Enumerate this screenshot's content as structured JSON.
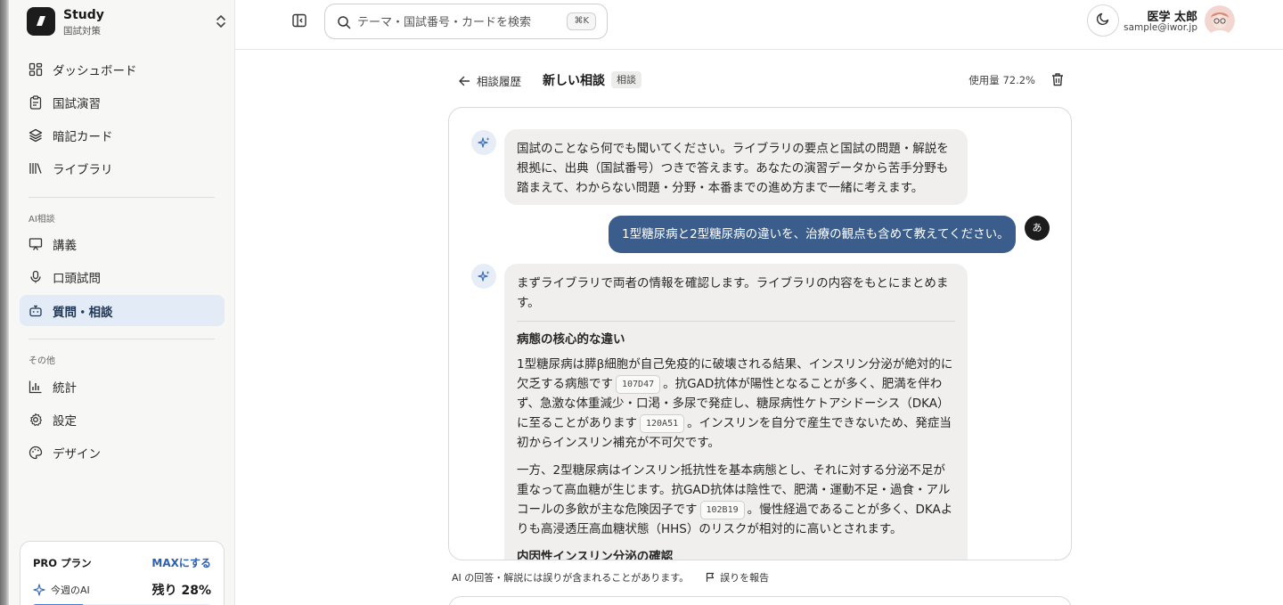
{
  "app": {
    "title": "Study",
    "subtitle": "国試対策"
  },
  "sidebar": {
    "main_items": [
      {
        "label": "ダッシュボード",
        "icon": "dashboard-icon"
      },
      {
        "label": "国試演習",
        "icon": "clipboard-icon"
      },
      {
        "label": "暗記カード",
        "icon": "layers-icon"
      },
      {
        "label": "ライブラリ",
        "icon": "library-icon"
      }
    ],
    "ai_section_label": "AI相談",
    "ai_items": [
      {
        "label": "講義",
        "icon": "presentation-icon"
      },
      {
        "label": "口頭試問",
        "icon": "microphone-icon"
      },
      {
        "label": "質問・相談",
        "icon": "bot-icon",
        "active": true
      }
    ],
    "other_section_label": "その他",
    "other_items": [
      {
        "label": "統計",
        "icon": "bar-chart-icon"
      },
      {
        "label": "設定",
        "icon": "gear-icon"
      },
      {
        "label": "デザイン",
        "icon": "palette-icon"
      }
    ],
    "plan": {
      "name": "PRO プラン",
      "upgrade_label": "MAXにする",
      "weekly_ai_label": "今週のAI",
      "remaining_label": "残り 28%",
      "remaining_fraction": 0.28
    }
  },
  "header": {
    "search_placeholder": "テーマ・国試番号・カードを検索",
    "search_shortcut": "⌘K",
    "user_name": "医学 太郎",
    "user_email": "sample@iwor.jp"
  },
  "chat": {
    "back_label": "相談履歴",
    "title": "新しい相談",
    "tag": "相談",
    "usage_label": "使用量 72.2%",
    "user_initial": "あ",
    "intro_message": "国試のことなら何でも聞いてください。ライブラリの要点と国試の問題・解説を根拠に、出典（国試番号）つきで答えます。あなたの演習データから苦手分野も踏まえて、わからない問題・分野・本番までの進め方まで一緒に考えます。",
    "user_message": "1型糖尿病と2型糖尿病の違いを、治療の観点も含めて教えてください。",
    "answer": {
      "lead": "まずライブラリで両者の情報を確認します。ライブラリの内容をもとにまとめます。",
      "heading1": "病態の核心的な違い",
      "p1_a": "1型糖尿病は膵β細胞が自己免疫的に破壊される結果、インスリン分泌が絶対的に欠乏する病態です",
      "p1_ref1": "107D47",
      "p1_b": "。抗GAD抗体が陽性となることが多く、肥満を伴わず、急激な体重減少・口渇・多尿で発症し、糖尿病性ケトアシドーシス（DKA）に至ることがあります",
      "p1_ref2": "120A51",
      "p1_c": "。インスリンを自分で産生できないため、発症当初からインスリン補充が不可欠です。",
      "p2_a": "一方、2型糖尿病はインスリン抵抗性を基本病態とし、それに対する分泌不足が重なって高血糖が生じます。抗GAD抗体は陰性で、肥満・運動不足・過食・アルコールの多飲が主な危険因子です",
      "p2_ref": "102B19",
      "p2_b": "。慢性経過であることが多く、DKAよりも高浸透圧高血糖状態（HHS）のリスクが相対的に高いとされます。",
      "heading2": "内因性インスリン分泌の確認"
    },
    "disclaimer": "AI の回答・解説には誤りが含まれることがあります。",
    "report_label": "誤りを報告"
  }
}
